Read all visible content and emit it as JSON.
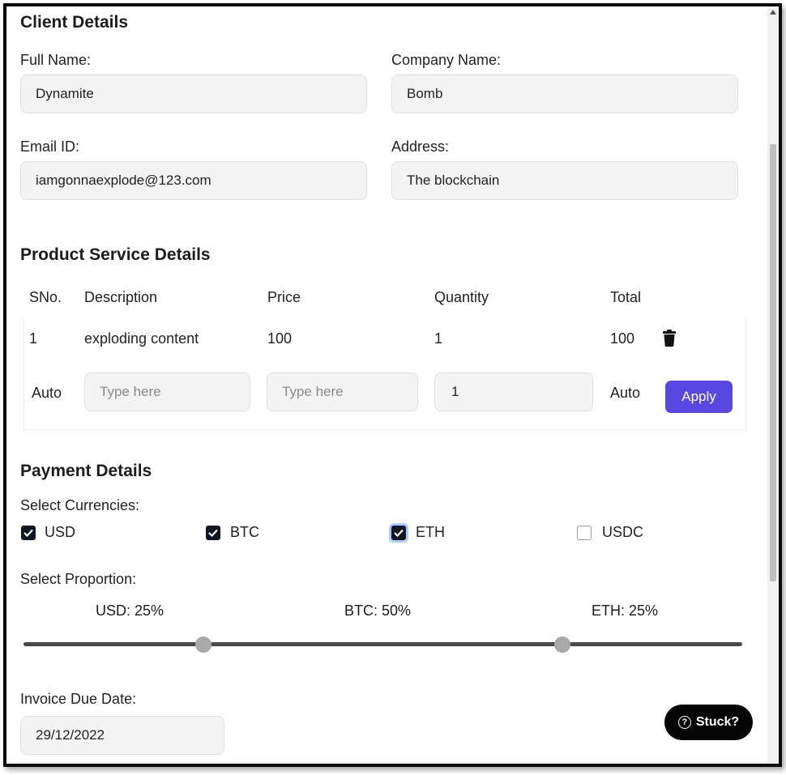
{
  "client": {
    "title": "Client Details",
    "full_name_label": "Full Name:",
    "full_name_value": "Dynamite",
    "company_label": "Company Name:",
    "company_value": "Bomb",
    "email_label": "Email ID:",
    "email_value": "iamgonnaexplode@123.com",
    "address_label": "Address:",
    "address_value": "The blockchain"
  },
  "product": {
    "title": "Product Service Details",
    "headers": [
      "SNo.",
      "Description",
      "Price",
      "Quantity",
      "Total"
    ],
    "rows": [
      {
        "sno": "1",
        "description": "exploding content",
        "price": "100",
        "quantity": "1",
        "total": "100"
      }
    ],
    "new_row": {
      "sno": "Auto",
      "description_placeholder": "Type here",
      "price_placeholder": "Type here",
      "quantity_value": "1",
      "total": "Auto",
      "apply_label": "Apply"
    },
    "delete_icon": "trash-icon"
  },
  "payment": {
    "title": "Payment Details",
    "currencies_label": "Select Currencies:",
    "currencies": [
      {
        "name": "USD",
        "checked": true
      },
      {
        "name": "BTC",
        "checked": true
      },
      {
        "name": "ETH",
        "checked": true
      },
      {
        "name": "USDC",
        "checked": false
      }
    ],
    "proportion_label": "Select Proportion:",
    "proportions": [
      {
        "label": "USD: 25%",
        "value": 25
      },
      {
        "label": "BTC: 50%",
        "value": 50
      },
      {
        "label": "ETH: 25%",
        "value": 25
      }
    ]
  },
  "due_date": {
    "label": "Invoice Due Date:",
    "value": "29/12/2022"
  },
  "help": {
    "label": "Stuck?",
    "icon": "question-circle-icon"
  },
  "colors": {
    "accent": "#5a46e0",
    "field_bg": "#f3f3f3",
    "checkbox_on": "#0f1722",
    "slider_thumb": "#a8a8a8"
  }
}
